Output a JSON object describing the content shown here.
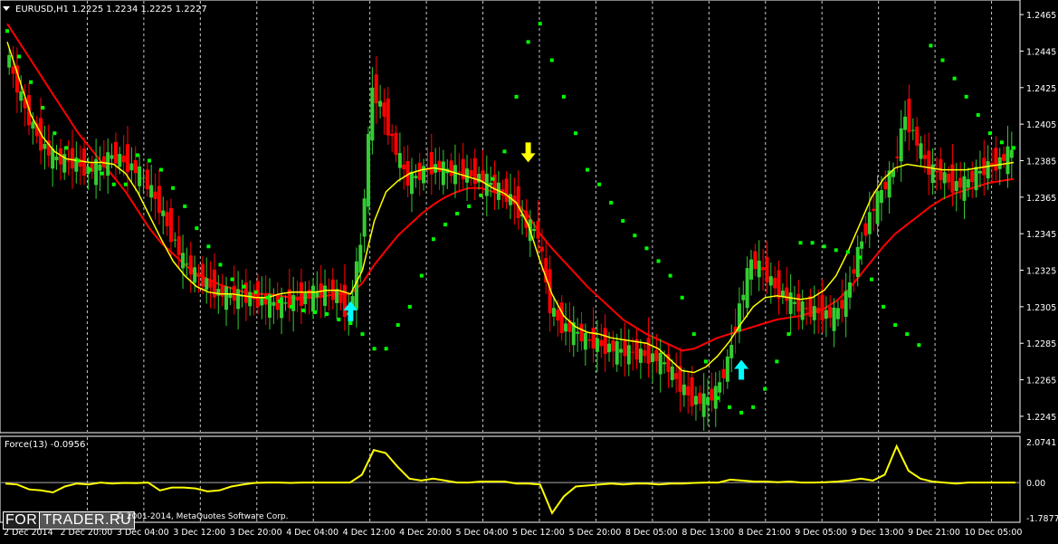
{
  "main_header": {
    "arrow_icon": "triangle-down-icon",
    "text": "EURUSD,H1  1.2225 1.2234 1.2225 1.2227"
  },
  "sub_header": {
    "text": "Force(13) -0.0956"
  },
  "watermark": {
    "part1": "FOR",
    "part2": "TRADER.RU"
  },
  "copyright": "© 2001-2014, MetaQuotes Software Corp.",
  "colors": {
    "background": "#000000",
    "bull_candle": "#32CD32",
    "bear_candle": "#FF0000",
    "ma_fast": "#FFFF00",
    "ma_slow": "#FF0000",
    "sar_dots": "#00FF00",
    "force_line": "#FFFF00",
    "buy_arrow": "#00FFFF",
    "sell_arrow": "#FFFF00"
  },
  "chart_data": [
    {
      "type": "candlestick",
      "title": "EURUSD,H1",
      "ylim": [
        1.224,
        1.247
      ],
      "y_ticks": [
        "1.2465",
        "1.2445",
        "1.2425",
        "1.2405",
        "1.2385",
        "1.2365",
        "1.2345",
        "1.2325",
        "1.2305",
        "1.2285",
        "1.2265",
        "1.2245"
      ],
      "x_ticks": [
        "2 Dec 2014",
        "2 Dec 20:00",
        "3 Dec 04:00",
        "3 Dec 12:00",
        "3 Dec 20:00",
        "4 Dec 04:00",
        "4 Dec 12:00",
        "4 Dec 20:00",
        "5 Dec 04:00",
        "5 Dec 12:00",
        "5 Dec 20:00",
        "8 Dec 05:00",
        "8 Dec 13:00",
        "8 Dec 21:00",
        "9 Dec 05:00",
        "9 Dec 13:00",
        "9 Dec 21:00",
        "10 Dec 05:00"
      ],
      "grid": "vertical dashed",
      "close_path": [
        1.2445,
        1.2425,
        1.2408,
        1.2395,
        1.2387,
        1.2385,
        1.2384,
        1.238,
        1.2382,
        1.2388,
        1.2385,
        1.238,
        1.2372,
        1.236,
        1.2345,
        1.233,
        1.2323,
        1.2318,
        1.2313,
        1.2311,
        1.2311,
        1.231,
        1.2308,
        1.2306,
        1.2308,
        1.231,
        1.2312,
        1.2313,
        1.2312,
        1.23,
        1.2338,
        1.2425,
        1.241,
        1.239,
        1.2374,
        1.2378,
        1.2382,
        1.238,
        1.2379,
        1.2378,
        1.2376,
        1.2372,
        1.2368,
        1.2362,
        1.235,
        1.2345,
        1.2305,
        1.2295,
        1.2292,
        1.2287,
        1.2285,
        1.2283,
        1.2281,
        1.228,
        1.2279,
        1.2277,
        1.2272,
        1.2262,
        1.2255,
        1.2253,
        1.2258,
        1.2275,
        1.2305,
        1.233,
        1.2325,
        1.2316,
        1.231,
        1.2305,
        1.2303,
        1.2302,
        1.23,
        1.231,
        1.2335,
        1.2355,
        1.2368,
        1.238,
        1.241,
        1.2395,
        1.238,
        1.2378,
        1.2372,
        1.2372,
        1.2378,
        1.2382,
        1.2385,
        1.239
      ],
      "series": [
        {
          "name": "",
          "kind": "ma_fast",
          "values": [
            1.245,
            1.243,
            1.241,
            1.2398,
            1.239,
            1.2386,
            1.2385,
            1.2384,
            1.2384,
            1.2383,
            1.2378,
            1.2368,
            1.2355,
            1.2342,
            1.233,
            1.2322,
            1.2316,
            1.2313,
            1.2312,
            1.2312,
            1.2311,
            1.231,
            1.231,
            1.2312,
            1.2313,
            1.2313,
            1.2313,
            1.2314,
            1.2314,
            1.2312,
            1.2325,
            1.2352,
            1.2368,
            1.2374,
            1.2378,
            1.238,
            1.2381,
            1.238,
            1.2378,
            1.2376,
            1.2374,
            1.237,
            1.2367,
            1.2362,
            1.235,
            1.233,
            1.2312,
            1.23,
            1.2294,
            1.2291,
            1.229,
            1.2288,
            1.2287,
            1.2286,
            1.2285,
            1.2282,
            1.2276,
            1.227,
            1.2269,
            1.2272,
            1.2278,
            1.2286,
            1.2296,
            1.2305,
            1.231,
            1.2311,
            1.231,
            1.2309,
            1.231,
            1.2314,
            1.2322,
            1.2335,
            1.235,
            1.2365,
            1.2375,
            1.2381,
            1.2383,
            1.2382,
            1.2381,
            1.238,
            1.238,
            1.238,
            1.2381,
            1.2382,
            1.2383,
            1.2384
          ]
        },
        {
          "name": "",
          "kind": "ma_slow",
          "values": [
            1.246,
            1.245,
            1.244,
            1.243,
            1.242,
            1.241,
            1.24,
            1.2392,
            1.2384,
            1.2376,
            1.2368,
            1.2358,
            1.2348,
            1.234,
            1.2334,
            1.2328,
            1.2323,
            1.232,
            1.2317,
            1.2315,
            1.2313,
            1.2312,
            1.2312,
            1.2311,
            1.231,
            1.231,
            1.231,
            1.2311,
            1.2312,
            1.2312,
            1.2318,
            1.2328,
            1.2336,
            1.2344,
            1.235,
            1.2356,
            1.2361,
            1.2365,
            1.2368,
            1.237,
            1.237,
            1.2368,
            1.2366,
            1.2362,
            1.2355,
            1.2345,
            1.2337,
            1.233,
            1.2323,
            1.2316,
            1.231,
            1.2304,
            1.2298,
            1.2294,
            1.229,
            1.2287,
            1.2284,
            1.2281,
            1.2282,
            1.2285,
            1.2288,
            1.229,
            1.2292,
            1.2294,
            1.2296,
            1.2298,
            1.2299,
            1.23,
            1.2302,
            1.2304,
            1.2308,
            1.2314,
            1.2322,
            1.233,
            1.2338,
            1.2345,
            1.235,
            1.2355,
            1.236,
            1.2364,
            1.2367,
            1.2369,
            1.2371,
            1.2373,
            1.2374,
            1.2375
          ]
        },
        {
          "name": "",
          "kind": "parabolic_sar",
          "values": [
            1.2456,
            1.2442,
            1.2428,
            1.2414,
            1.24,
            1.2392,
            1.2385,
            1.238,
            1.2378,
            1.2372,
            1.2372,
            1.2388,
            1.2385,
            1.238,
            1.237,
            1.236,
            1.2348,
            1.2338,
            1.2328,
            1.232,
            1.2316,
            1.2313,
            1.231,
            1.2308,
            1.2305,
            1.2303,
            1.2302,
            1.2301,
            1.2298,
            1.2296,
            1.229,
            1.2282,
            1.2282,
            1.2295,
            1.2305,
            1.2322,
            1.2342,
            1.235,
            1.2356,
            1.236,
            1.2366,
            1.2375,
            1.239,
            1.242,
            1.245,
            1.246,
            1.244,
            1.242,
            1.24,
            1.238,
            1.2372,
            1.2362,
            1.2352,
            1.2344,
            1.2337,
            1.233,
            1.2322,
            1.231,
            1.229,
            1.2275,
            1.2255,
            1.225,
            1.2247,
            1.225,
            1.226,
            1.2275,
            1.229,
            1.234,
            1.234,
            1.2338,
            1.2336,
            1.2335,
            1.2332,
            1.232,
            1.2305,
            1.2295,
            1.229,
            1.2284,
            1.2448,
            1.244,
            1.243,
            1.242,
            1.241,
            1.24,
            1.2395,
            1.2392
          ]
        }
      ],
      "signals": [
        {
          "type": "buy",
          "icon": "arrow-up-icon",
          "x_index": 29,
          "price": 1.2302
        },
        {
          "type": "sell",
          "icon": "arrow-down-icon",
          "x_index": 44,
          "price": 1.239
        },
        {
          "type": "buy",
          "icon": "arrow-up-icon",
          "x_index": 62,
          "price": 1.227
        }
      ]
    },
    {
      "type": "line",
      "title": "Force(13) -0.0956",
      "ylim": [
        -1.7877,
        2.0741
      ],
      "y_ticks": [
        "2.0741",
        "0.00",
        "-1.7877"
      ],
      "series": [
        {
          "name": "",
          "values": [
            -0.05,
            -0.1,
            -0.35,
            -0.4,
            -0.5,
            -0.2,
            -0.05,
            -0.1,
            0.0,
            -0.05,
            -0.02,
            -0.03,
            0.0,
            -0.4,
            -0.25,
            -0.25,
            -0.3,
            -0.45,
            -0.4,
            -0.2,
            -0.1,
            -0.02,
            0.0,
            0.0,
            -0.02,
            0.0,
            0.0,
            0.0,
            0.0,
            0.0,
            0.4,
            1.65,
            1.5,
            0.8,
            0.2,
            0.1,
            0.2,
            0.1,
            0.0,
            0.0,
            0.05,
            0.05,
            0.05,
            -0.05,
            -0.05,
            -0.1,
            -1.55,
            -0.7,
            -0.2,
            -0.15,
            -0.1,
            -0.05,
            -0.1,
            -0.05,
            -0.05,
            -0.1,
            -0.05,
            -0.05,
            -0.02,
            0.0,
            0.0,
            0.15,
            0.1,
            0.05,
            0.05,
            0.02,
            0.05,
            0.0,
            0.0,
            0.02,
            0.05,
            0.1,
            0.2,
            0.1,
            0.4,
            1.85,
            0.6,
            0.2,
            0.05,
            0.0,
            -0.05,
            0.0,
            0.0,
            0.0,
            0.0,
            0.0
          ]
        }
      ]
    }
  ]
}
